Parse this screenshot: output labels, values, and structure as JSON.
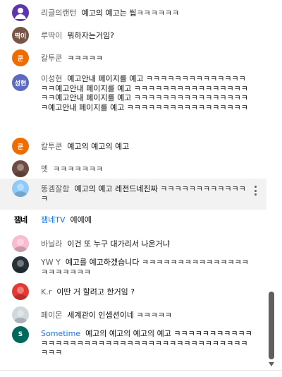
{
  "messages": [
    {
      "author": "리글의랜턴",
      "text": "예고의 예고는 씹ㅋㅋㅋㅋㅋㅋ",
      "avatar": {
        "kind": "person",
        "color": "#5e35b1"
      }
    },
    {
      "author": "루딱이",
      "text": "뭐하자는거임?",
      "avatar": {
        "kind": "text",
        "label": "딱이",
        "color": "#795548"
      }
    },
    {
      "author": "칼투쿤",
      "text": "ㅋㅋㅋㅋㅋ",
      "avatar": {
        "kind": "text",
        "label": "쿤",
        "color": "#ef6c00"
      }
    },
    {
      "author": "이성현",
      "text": "예고안내 페이지를 예고 ㅋㅋㅋㅋㅋㅋㅋㅋㅋㅋㅋㅋㅋㅋㅋㅋ예고안내 페이지를 예고 ㅋㅋㅋㅋㅋㅋㅋㅋㅋㅋㅋㅋㅋㅋㅋㅋㅋㅋ예고안내 페이지를 예고 ㅋㅋㅋㅋㅋㅋㅋㅋㅋㅋㅋㅋㅋㅋㅋㅋㅋ예고안내 페이지를 예고 ㅋㅋㅋㅋㅋㅋㅋㅋㅋㅋㅋㅋㅋㅋㅋㅋㅋ",
      "avatar": {
        "kind": "text",
        "label": "성현",
        "color": "#5c6bc0"
      }
    },
    {
      "author": "칼투쿤",
      "text": "예고의 예고의 예고",
      "avatar": {
        "kind": "text",
        "label": "쿤",
        "color": "#ef6c00"
      }
    },
    {
      "author": "멧",
      "text": "ㅋㅋㅋㅋㅋㅋㅋ",
      "avatar": {
        "kind": "photo",
        "color": "#6d4c41"
      }
    },
    {
      "author": "똥겜잘함",
      "text": "예고의 예고 레전드네진짜 ㅋㅋㅋㅋㅋㅋㅋㅋㅋㅋㅋㅋㅋ",
      "avatar": {
        "kind": "photo",
        "color": "#90caf9"
      },
      "highlighted": true
    },
    {
      "author": "잼네TV",
      "text": "예예예",
      "avatar": {
        "kind": "logo",
        "label": "잼네",
        "color": "#ffffff"
      },
      "member": true
    },
    {
      "author": "바닐라",
      "text": "이건 또 누구 대가리서 나온거냐",
      "avatar": {
        "kind": "photo",
        "color": "#f8bbd0"
      }
    },
    {
      "author": "YW Y",
      "text": "예고를 예고하겠습니다 ㅋㅋㅋㅋㅋㅋㅋㅋㅋㅋㅋㅋㅋㅋㅋㅋㅋㅋㅋㅋㅋㅋ",
      "avatar": {
        "kind": "photo",
        "color": "#263238"
      }
    },
    {
      "author": "K.r",
      "text": "이딴 거 할려고 한거임 ?",
      "avatar": {
        "kind": "photo",
        "color": "#e53935"
      }
    },
    {
      "author": "페이몬",
      "text": "세계관이 인셉션이네 ㅋㅋㅋㅋㅋ",
      "avatar": {
        "kind": "photo",
        "color": "#cfd8dc"
      }
    },
    {
      "author": "Sometime",
      "text": "예고의 예고의 예고의 예고 ㅋㅋㅋㅋㅋㅋㅋㅋㅋㅋㅋㅋㅋㅋㅋㅋㅋㅋㅋㅋㅋㅋㅋㅋㅋㅋㅋㅋㅋㅋㅋㅋㅋㅋㅋㅋㅋㅋㅋㅋㅋㅋㅋ",
      "avatar": {
        "kind": "text",
        "label": "S",
        "color": "#00695c"
      },
      "member": true
    }
  ],
  "icons": {
    "more": "more-vert-icon",
    "scroll_down": "arrow-down-icon"
  }
}
